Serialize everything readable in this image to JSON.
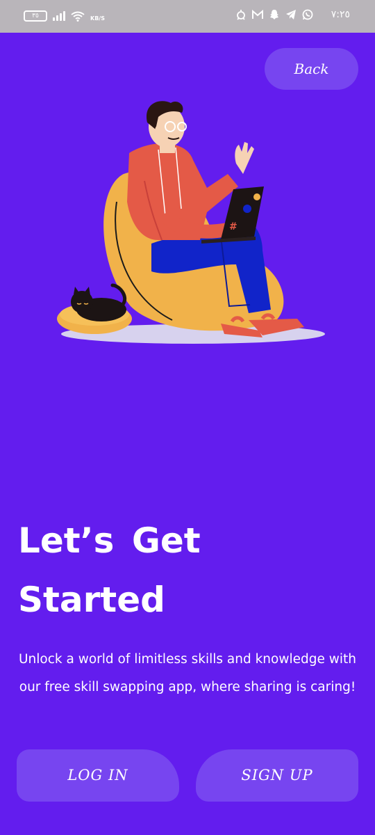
{
  "status_bar": {
    "battery_level": "٣٥",
    "network_speed": "KB/S",
    "time": "٧:٢٥",
    "icons": [
      "alarm-icon",
      "gmail-icon",
      "snapchat-icon",
      "telegram-icon",
      "whatsapp-icon"
    ]
  },
  "header": {
    "back_label": "Back"
  },
  "hero": {
    "title_line1": "Let’s  Get",
    "title_line2": "Started",
    "description": "Unlock a world of limitless skills and knowledge with our free skill swapping app, where sharing is caring!"
  },
  "actions": {
    "login_label": "LOG IN",
    "signup_label": "SIGN UP"
  },
  "colors": {
    "background": "#631DEE",
    "button": "#7745F0",
    "status_bar": "#B9B5BA",
    "text": "#FFFFFF"
  }
}
